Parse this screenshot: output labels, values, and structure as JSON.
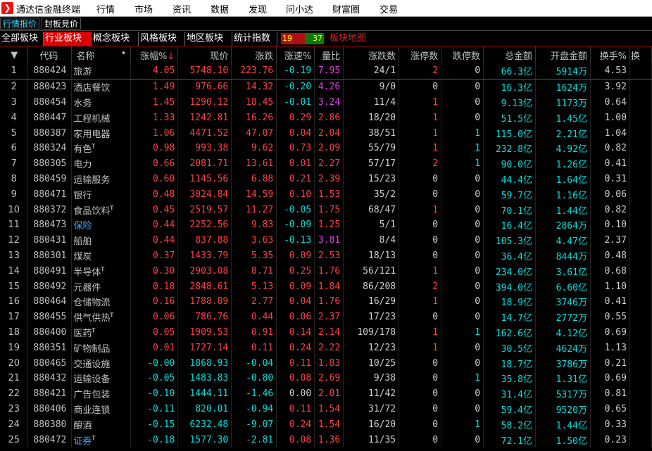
{
  "app": {
    "title": "通达信金融终端",
    "logo_color": "#e11111"
  },
  "menu": [
    "行情",
    "市场",
    "资讯",
    "数据",
    "发现",
    "问小达",
    "财富圈",
    "交易"
  ],
  "subtabs": [
    "行情报价",
    "封板竞价"
  ],
  "categories": [
    "全部板块",
    "行业板块",
    "概念板块",
    "风格板块",
    "地区板块",
    "统计指数"
  ],
  "active_category": "行业板块",
  "counts": {
    "up": "19",
    "down": "37"
  },
  "map_link": "板块地图",
  "columns": [
    "代码",
    "名称",
    "涨幅%",
    "现价",
    "涨跌",
    "涨速%",
    "量比",
    "涨跌数",
    "涨停数",
    "跌停数",
    "总金额",
    "开盘金额",
    "换手%",
    "换"
  ],
  "sort_marker": "•",
  "rows": [
    {
      "i": "1",
      "code": "880424",
      "name": "旅游",
      "t": "",
      "chg": "4.05",
      "price": "5748.10",
      "diff": "223.76",
      "spd": "-0.19",
      "vr": "7.95",
      "ud": "24/1",
      "lu": "2",
      "ld": "0",
      "amt": "66.3",
      "amtu": "亿",
      "open": "5914",
      "openu": "万",
      "turn": "4.53"
    },
    {
      "i": "2",
      "code": "880423",
      "name": "酒店餐饮",
      "t": "",
      "chg": "1.49",
      "price": "976.66",
      "diff": "14.32",
      "spd": "-0.20",
      "vr": "4.26",
      "ud": "9/0",
      "lu": "0",
      "ld": "0",
      "amt": "16.3",
      "amtu": "亿",
      "open": "1624",
      "openu": "万",
      "turn": "3.92"
    },
    {
      "i": "3",
      "code": "880454",
      "name": "水务",
      "t": "",
      "chg": "1.45",
      "price": "1290.12",
      "diff": "18.45",
      "spd": "-0.01",
      "vr": "3.24",
      "ud": "11/4",
      "lu": "1",
      "ld": "0",
      "amt": "9.13",
      "amtu": "亿",
      "open": "1173",
      "openu": "万",
      "turn": "0.64"
    },
    {
      "i": "4",
      "code": "880447",
      "name": "工程机械",
      "t": "",
      "chg": "1.33",
      "price": "1242.81",
      "diff": "16.26",
      "spd": "0.29",
      "vr": "2.86",
      "ud": "18/20",
      "lu": "1",
      "ld": "0",
      "amt": "51.5",
      "amtu": "亿",
      "open": "1.45",
      "openu": "亿",
      "turn": "1.00"
    },
    {
      "i": "5",
      "code": "880387",
      "name": "家用电器",
      "t": "",
      "chg": "1.06",
      "price": "4471.52",
      "diff": "47.07",
      "spd": "0.04",
      "vr": "2.04",
      "ud": "38/51",
      "lu": "1",
      "ld": "1",
      "amt": "115.0",
      "amtu": "亿",
      "open": "2.21",
      "openu": "亿",
      "turn": "1.04"
    },
    {
      "i": "6",
      "code": "880324",
      "name": "有色",
      "t": "T",
      "chg": "0.98",
      "price": "993.38",
      "diff": "9.62",
      "spd": "0.73",
      "vr": "2.09",
      "ud": "55/79",
      "lu": "1",
      "ld": "1",
      "amt": "232.8",
      "amtu": "亿",
      "open": "4.92",
      "openu": "亿",
      "turn": "0.82"
    },
    {
      "i": "7",
      "code": "880305",
      "name": "电力",
      "t": "",
      "chg": "0.66",
      "price": "2081.71",
      "diff": "13.61",
      "spd": "0.01",
      "vr": "2.27",
      "ud": "57/17",
      "lu": "2",
      "ld": "1",
      "amt": "90.0",
      "amtu": "亿",
      "open": "1.26",
      "openu": "亿",
      "turn": "0.41"
    },
    {
      "i": "8",
      "code": "880459",
      "name": "运输服务",
      "t": "",
      "chg": "0.60",
      "price": "1145.56",
      "diff": "6.88",
      "spd": "0.21",
      "vr": "2.39",
      "ud": "15/23",
      "lu": "0",
      "ld": "0",
      "amt": "44.4",
      "amtu": "亿",
      "open": "1.64",
      "openu": "亿",
      "turn": "0.31"
    },
    {
      "i": "9",
      "code": "880471",
      "name": "银行",
      "t": "",
      "chg": "0.48",
      "price": "3024.84",
      "diff": "14.59",
      "spd": "0.10",
      "vr": "1.53",
      "ud": "35/2",
      "lu": "0",
      "ld": "0",
      "amt": "59.7",
      "amtu": "亿",
      "open": "1.16",
      "openu": "亿",
      "turn": "0.06"
    },
    {
      "i": "10",
      "code": "880372",
      "name": "食品饮料",
      "t": "T",
      "chg": "0.45",
      "price": "2519.57",
      "diff": "11.27",
      "spd": "-0.05",
      "vr": "1.75",
      "ud": "68/47",
      "lu": "1",
      "ld": "0",
      "amt": "70.1",
      "amtu": "亿",
      "open": "1.44",
      "openu": "亿",
      "turn": "0.82"
    },
    {
      "i": "11",
      "code": "880473",
      "name": "保险",
      "t": "",
      "blue": true,
      "chg": "0.44",
      "price": "2252.56",
      "diff": "9.83",
      "spd": "-0.09",
      "vr": "1.25",
      "ud": "5/1",
      "lu": "0",
      "ld": "0",
      "amt": "16.4",
      "amtu": "亿",
      "open": "2864",
      "openu": "万",
      "turn": "0.10"
    },
    {
      "i": "12",
      "code": "880431",
      "name": "船舶",
      "t": "",
      "chg": "0.44",
      "price": "837.88",
      "diff": "3.63",
      "spd": "-0.13",
      "vr": "3.81",
      "ud": "8/4",
      "lu": "0",
      "ld": "0",
      "amt": "105.3",
      "amtu": "亿",
      "open": "4.47",
      "openu": "亿",
      "turn": "2.37"
    },
    {
      "i": "13",
      "code": "880301",
      "name": "煤炭",
      "t": "",
      "chg": "0.37",
      "price": "1433.79",
      "diff": "5.35",
      "spd": "0.09",
      "vr": "2.53",
      "ud": "18/13",
      "lu": "0",
      "ld": "0",
      "amt": "36.4",
      "amtu": "亿",
      "open": "8444",
      "openu": "万",
      "turn": "0.48"
    },
    {
      "i": "14",
      "code": "880491",
      "name": "半导体",
      "t": "T",
      "chg": "0.30",
      "price": "2903.08",
      "diff": "8.71",
      "spd": "0.25",
      "vr": "1.76",
      "ud": "56/121",
      "lu": "1",
      "ld": "0",
      "amt": "234.0",
      "amtu": "亿",
      "open": "3.61",
      "openu": "亿",
      "turn": "0.68"
    },
    {
      "i": "15",
      "code": "880492",
      "name": "元器件",
      "t": "",
      "chg": "0.18",
      "price": "2848.61",
      "diff": "5.13",
      "spd": "0.09",
      "vr": "1.84",
      "ud": "86/208",
      "lu": "2",
      "ld": "0",
      "amt": "394.0",
      "amtu": "亿",
      "open": "6.60",
      "openu": "亿",
      "turn": "1.10"
    },
    {
      "i": "16",
      "code": "880464",
      "name": "仓储物流",
      "t": "",
      "chg": "0.16",
      "price": "1788.89",
      "diff": "2.77",
      "spd": "0.04",
      "vr": "1.76",
      "ud": "16/29",
      "lu": "1",
      "ld": "0",
      "amt": "18.9",
      "amtu": "亿",
      "open": "3746",
      "openu": "万",
      "turn": "0.41"
    },
    {
      "i": "17",
      "code": "880455",
      "name": "供气供热",
      "t": "T",
      "chg": "0.06",
      "price": "786.76",
      "diff": "0.44",
      "spd": "0.06",
      "vr": "2.37",
      "ud": "17/23",
      "lu": "0",
      "ld": "0",
      "amt": "14.7",
      "amtu": "亿",
      "open": "2772",
      "openu": "万",
      "turn": "0.55"
    },
    {
      "i": "18",
      "code": "880400",
      "name": "医药",
      "t": "T",
      "chg": "0.05",
      "price": "1909.53",
      "diff": "0.91",
      "spd": "0.14",
      "vr": "2.14",
      "ud": "109/178",
      "lu": "1",
      "ld": "1",
      "amt": "162.6",
      "amtu": "亿",
      "open": "4.12",
      "openu": "亿",
      "turn": "0.69"
    },
    {
      "i": "19",
      "code": "880351",
      "name": "矿物制品",
      "t": "",
      "chg": "0.01",
      "price": "1727.14",
      "diff": "0.11",
      "spd": "0.24",
      "vr": "2.22",
      "ud": "12/23",
      "lu": "1",
      "ld": "0",
      "amt": "30.5",
      "amtu": "亿",
      "open": "4624",
      "openu": "万",
      "turn": "1.13"
    },
    {
      "i": "20",
      "code": "880465",
      "name": "交通设施",
      "t": "",
      "chg": "-0.00",
      "price": "1868.93",
      "diff": "-0.04",
      "spd": "0.11",
      "vr": "1.83",
      "ud": "10/25",
      "lu": "0",
      "ld": "0",
      "amt": "18.7",
      "amtu": "亿",
      "open": "3786",
      "openu": "万",
      "turn": "0.21"
    },
    {
      "i": "21",
      "code": "880432",
      "name": "运输设备",
      "t": "",
      "chg": "-0.05",
      "price": "1483.83",
      "diff": "-0.80",
      "spd": "0.08",
      "vr": "2.69",
      "ud": "9/38",
      "lu": "0",
      "ld": "1",
      "amt": "35.8",
      "amtu": "亿",
      "open": "1.31",
      "openu": "亿",
      "turn": "0.69"
    },
    {
      "i": "22",
      "code": "880421",
      "name": "广告包装",
      "t": "",
      "chg": "-0.10",
      "price": "1444.11",
      "diff": "-1.46",
      "spd": "0.00",
      "vr": "2.01",
      "ud": "11/42",
      "lu": "0",
      "ld": "0",
      "amt": "31.4",
      "amtu": "亿",
      "open": "5317",
      "openu": "万",
      "turn": "0.81"
    },
    {
      "i": "23",
      "code": "880406",
      "name": "商业连锁",
      "t": "",
      "chg": "-0.11",
      "price": "820.01",
      "diff": "-0.94",
      "spd": "0.11",
      "vr": "1.54",
      "ud": "31/72",
      "lu": "0",
      "ld": "0",
      "amt": "59.4",
      "amtu": "亿",
      "open": "9520",
      "openu": "万",
      "turn": "0.65"
    },
    {
      "i": "24",
      "code": "880380",
      "name": "酿酒",
      "t": "",
      "chg": "-0.15",
      "price": "6232.48",
      "diff": "-9.07",
      "spd": "0.24",
      "vr": "1.54",
      "ud": "16/20",
      "lu": "0",
      "ld": "1",
      "amt": "58.2",
      "amtu": "亿",
      "open": "1.44",
      "openu": "亿",
      "turn": "0.33"
    },
    {
      "i": "25",
      "code": "880472",
      "name": "证券",
      "t": "T",
      "blue": true,
      "chg": "-0.18",
      "price": "1577.30",
      "diff": "-2.81",
      "spd": "0.08",
      "vr": "1.36",
      "ud": "11/35",
      "lu": "0",
      "ld": "0",
      "amt": "72.1",
      "amtu": "亿",
      "open": "1.50",
      "openu": "亿",
      "turn": "0.23"
    }
  ]
}
